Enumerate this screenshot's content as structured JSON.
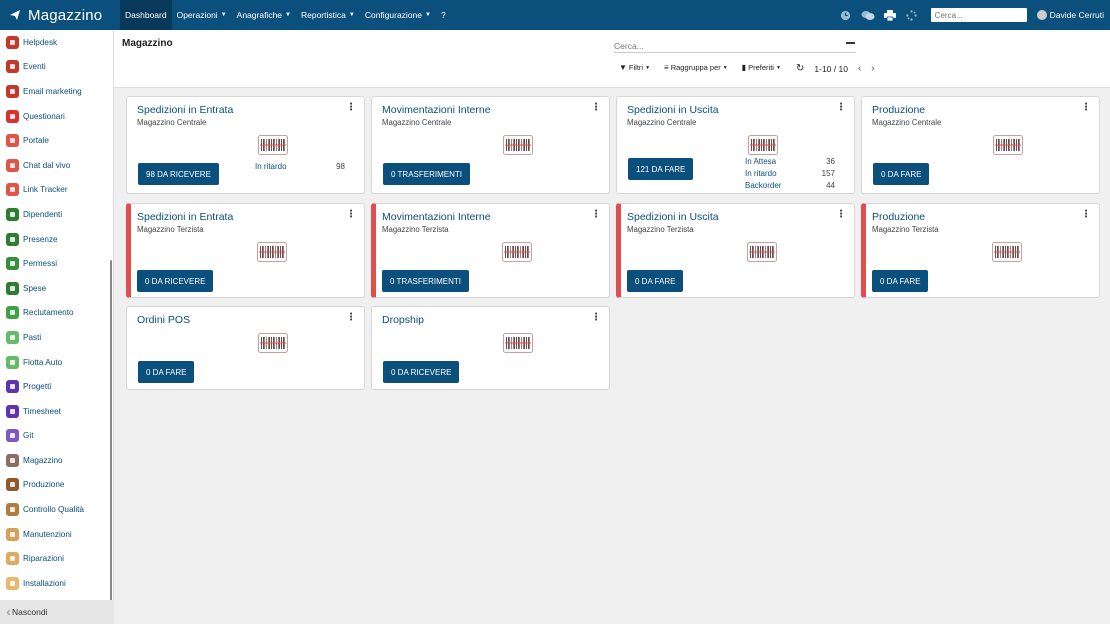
{
  "app": {
    "title": "Magazzino"
  },
  "nav": {
    "items": [
      {
        "label": "Dashboard",
        "caret": false,
        "active": true
      },
      {
        "label": "Operazioni",
        "caret": true,
        "active": false
      },
      {
        "label": "Anagrafiche",
        "caret": true,
        "active": false
      },
      {
        "label": "Reportistica",
        "caret": true,
        "active": false
      },
      {
        "label": "Configurazione",
        "caret": true,
        "active": false
      },
      {
        "label": "?",
        "caret": false,
        "active": false
      }
    ],
    "search_placeholder": "Cerca...",
    "user": "Davide Cerruti"
  },
  "sidebar": {
    "items": [
      {
        "label": "Helpdesk",
        "icon": "headset-icon",
        "color": "#c0392b"
      },
      {
        "label": "Eventi",
        "icon": "ticket-icon",
        "color": "#c0392b"
      },
      {
        "label": "Email marketing",
        "icon": "paper-plane-icon",
        "color": "#c0392b"
      },
      {
        "label": "Questionari",
        "icon": "clipboard-icon",
        "color": "#d9322e"
      },
      {
        "label": "Portale",
        "icon": "globe-icon",
        "color": "#e05547"
      },
      {
        "label": "Chat dal vivo",
        "icon": "chat-icon",
        "color": "#e05547"
      },
      {
        "label": "Link Tracker",
        "icon": "link-icon",
        "color": "#e05547"
      },
      {
        "label": "Dipendenti",
        "icon": "users-icon",
        "color": "#2e7d32"
      },
      {
        "label": "Presenze",
        "icon": "user-check-icon",
        "color": "#2e7d32"
      },
      {
        "label": "Permessi",
        "icon": "calendar-icon",
        "color": "#388e3c"
      },
      {
        "label": "Spese",
        "icon": "dollar-icon",
        "color": "#2e7d32"
      },
      {
        "label": "Reclutamento",
        "icon": "search-user-icon",
        "color": "#43a047"
      },
      {
        "label": "Pasti",
        "icon": "cutlery-icon",
        "color": "#66bb6a"
      },
      {
        "label": "Flotta Auto",
        "icon": "car-icon",
        "color": "#66bb6a"
      },
      {
        "label": "Progetti",
        "icon": "puzzle-icon",
        "color": "#5e35b1"
      },
      {
        "label": "Timesheet",
        "icon": "clock-icon",
        "color": "#5e35b1"
      },
      {
        "label": "Git",
        "icon": "git-icon",
        "color": "#7e57c2"
      },
      {
        "label": "Magazzino",
        "icon": "box-icon",
        "color": "#8d6e63"
      },
      {
        "label": "Produzione",
        "icon": "wrench-icon",
        "color": "#8d5a2b"
      },
      {
        "label": "Controllo Qualità",
        "icon": "quality-icon",
        "color": "#b07b3b"
      },
      {
        "label": "Manutenzioni",
        "icon": "hammer-icon",
        "color": "#d9a05b"
      },
      {
        "label": "Riparazioni",
        "icon": "tools-icon",
        "color": "#e0a860"
      },
      {
        "label": "Installazioni",
        "icon": "install-icon",
        "color": "#e8b86d"
      }
    ],
    "hide_label": "Nascondi"
  },
  "control_panel": {
    "breadcrumb": "Magazzino",
    "search_placeholder": "Cerca...",
    "filters_label": "Filtri",
    "groupby_label": "Raggruppa per",
    "favorites_label": "Preferiti",
    "pager": "1-10 / 10"
  },
  "cards": [
    {
      "title": "Spedizioni in Entrata",
      "subtitle": "Magazzino Centrale",
      "button": "98 DA RICEVERE",
      "warn": false,
      "stats": [
        {
          "label": "In ritardo",
          "value": "98"
        }
      ]
    },
    {
      "title": "Movimentazioni Interne",
      "subtitle": "Magazzino Centrale",
      "button": "0 TRASFERIMENTI",
      "warn": false,
      "stats": []
    },
    {
      "title": "Spedizioni in Uscita",
      "subtitle": "Magazzino Centrale",
      "button": "121 DA FARE",
      "warn": false,
      "stats": [
        {
          "label": "In Attesa",
          "value": "36"
        },
        {
          "label": "In ritardo",
          "value": "157"
        },
        {
          "label": "Backorder",
          "value": "44"
        }
      ]
    },
    {
      "title": "Produzione",
      "subtitle": "Magazzino Centrale",
      "button": "0 DA FARE",
      "warn": false,
      "stats": []
    },
    {
      "title": "Spedizioni in Entrata",
      "subtitle": "Magazzino Terzista",
      "button": "0 DA RICEVERE",
      "warn": true,
      "stats": []
    },
    {
      "title": "Movimentazioni Interne",
      "subtitle": "Magazzino Terzista",
      "button": "0 TRASFERIMENTI",
      "warn": true,
      "stats": []
    },
    {
      "title": "Spedizioni in Uscita",
      "subtitle": "Magazzino Terzista",
      "button": "0 DA FARE",
      "warn": true,
      "stats": []
    },
    {
      "title": "Produzione",
      "subtitle": "Magazzino Terzista",
      "button": "0 DA FARE",
      "warn": true,
      "stats": []
    },
    {
      "title": "Ordini POS",
      "subtitle": "",
      "button": "0 DA FARE",
      "warn": false,
      "stats": []
    },
    {
      "title": "Dropship",
      "subtitle": "",
      "button": "0 DA RICEVERE",
      "warn": false,
      "stats": []
    }
  ]
}
